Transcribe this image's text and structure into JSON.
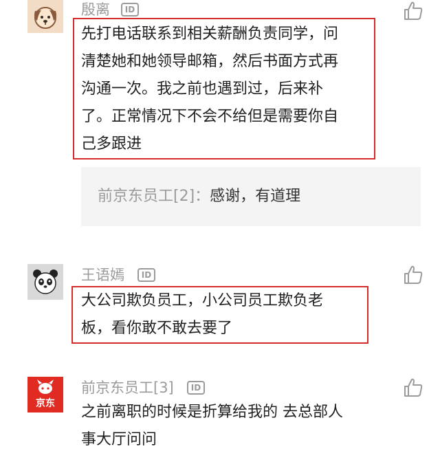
{
  "comments": [
    {
      "username": "殷离",
      "id_badge": "ID",
      "avatar": "dog-avatar-icon",
      "text_lines": [
        "先打电话联系到相关薪酬负责同学，问",
        "清楚她和她领导邮箱，然后书面方式再",
        "沟通一次。我之前也遇到过，后来补",
        "了。正常情况下不会不给但是需要你自",
        "己多跟进"
      ],
      "reply": {
        "author": "前京东员工[2]：",
        "text": "感谢，有道理"
      }
    },
    {
      "username": "王语嫣",
      "id_badge": "ID",
      "avatar": "panda-avatar-icon",
      "text_lines": [
        "大公司欺负员工，小公司员工欺负老",
        "板，看你敢不敢去要了"
      ]
    },
    {
      "username": "前京东员工[3]",
      "id_badge": "ID",
      "avatar": "jd-logo-avatar-icon",
      "avatar_text": "京东",
      "text_lines": [
        "之前离职的时候是折算给我的 去总部人",
        "事大厅问问"
      ]
    }
  ],
  "colors": {
    "highlight_border": "#d42a2a",
    "muted_text": "#9a9a9a",
    "reply_bg": "#f4f4f4",
    "jd_red": "#e02a22"
  }
}
